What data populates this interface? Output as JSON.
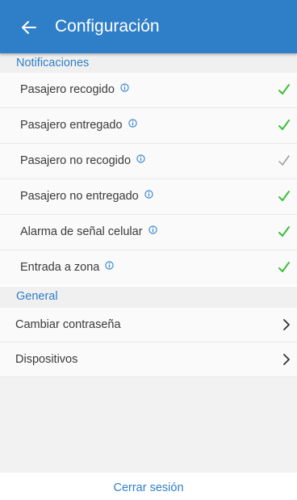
{
  "header": {
    "title": "Configuración",
    "back_icon": "arrow-left-icon",
    "background_color": "#2f7fc8"
  },
  "notifications": {
    "section_title": "Notificaciones",
    "items": [
      {
        "label": "Pasajero recogido",
        "enabled": true
      },
      {
        "label": "Pasajero entregado",
        "enabled": true
      },
      {
        "label": "Pasajero no recogido",
        "enabled": false
      },
      {
        "label": "Pasajero no entregado",
        "enabled": true
      },
      {
        "label": "Alarma de señal celular",
        "enabled": true
      },
      {
        "label": "Entrada a zona",
        "enabled": true
      }
    ],
    "enabled_color": "#3cbf3c",
    "disabled_color": "#9a9a9a"
  },
  "general": {
    "section_title": "General",
    "items": [
      {
        "label": "Cambiar contraseña"
      },
      {
        "label": "Dispositivos"
      }
    ]
  },
  "footer": {
    "logout_label": "Cerrar sesión"
  }
}
